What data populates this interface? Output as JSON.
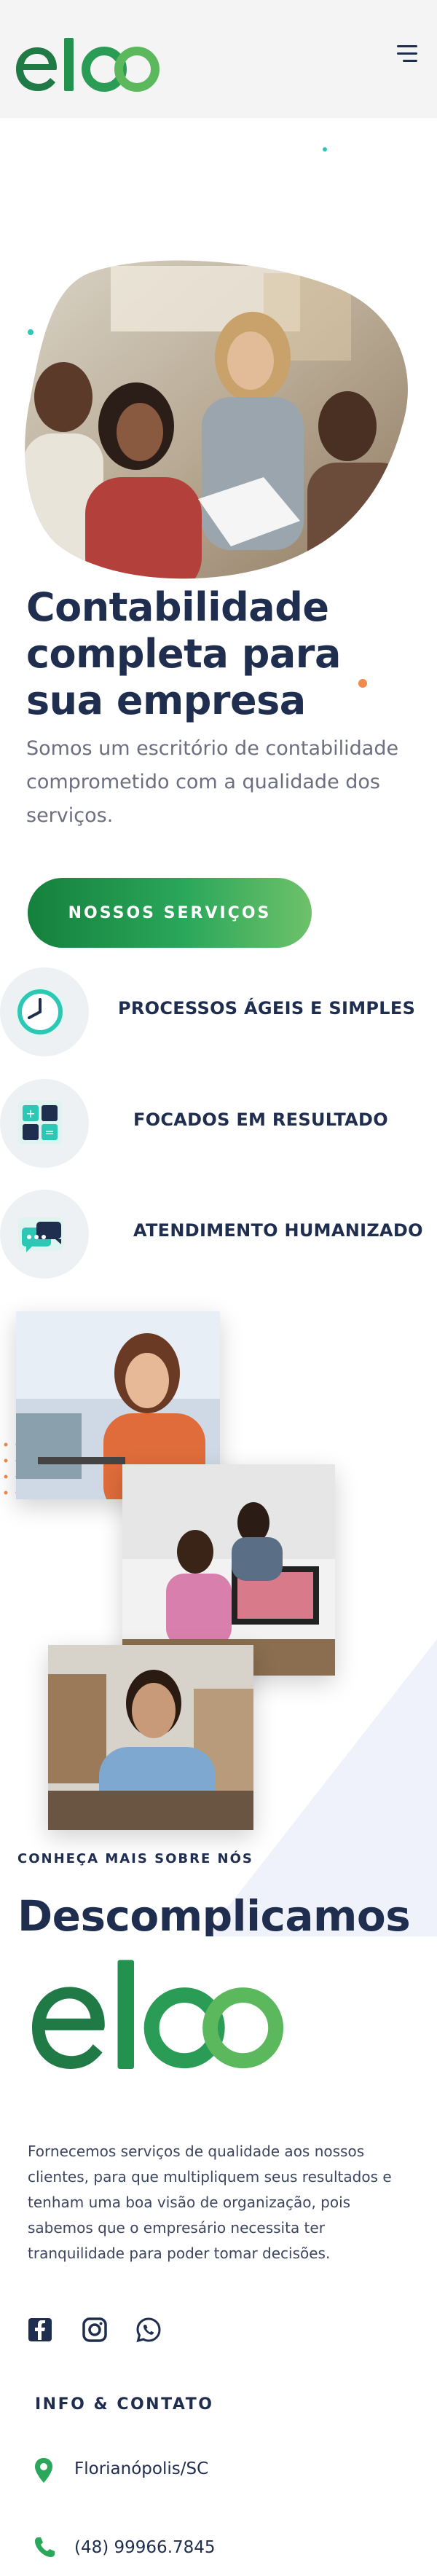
{
  "header": {
    "logo_text": "eloo",
    "menu_icon": "hamburger-menu-icon"
  },
  "hero": {
    "title_line1": "Contabilidade",
    "title_line2": "completa para",
    "title_line3": "sua empresa",
    "subtitle": "Somos um escritório de contabilidade comprometido com a qualidade dos serviços.",
    "cta_label": "NOSSOS SERVIÇOS",
    "image": "team-working-photo"
  },
  "features": [
    {
      "label": "PROCESSOS ÁGEIS E SIMPLES",
      "icon": "clock-icon"
    },
    {
      "label": "FOCADOS EM RESULTADO",
      "icon": "calculator-icon"
    },
    {
      "label": "ATENDIMENTO HUMANIZADO",
      "icon": "chat-bubbles-icon"
    }
  ],
  "about": {
    "kicker": "CONHEÇA MAIS SOBRE NÓS",
    "title": "Descomplicamos",
    "photos": [
      "smiling-woman-photo",
      "office-team-photo",
      "smiling-man-photo"
    ]
  },
  "footer": {
    "logo_text": "eloo",
    "description": "Fornecemos serviços de qualidade aos nossos clientes, para que multipliquem seus resultados e tenham uma boa visão de organização, pois sabemos que o empresário necessita ter tranquilidade para poder tomar decisões.",
    "social": [
      "facebook-icon",
      "instagram-icon",
      "whatsapp-icon"
    ],
    "info_title": "INFO & CONTATO",
    "location": "Florianópolis/SC",
    "phone": "(48) 99966.7845"
  },
  "colors": {
    "brand_green": "#1f8a4c",
    "brand_green_light": "#6ec16a",
    "navy": "#1f2d4f",
    "accent_orange": "#f08a4b",
    "accent_teal": "#2cc7b5"
  }
}
